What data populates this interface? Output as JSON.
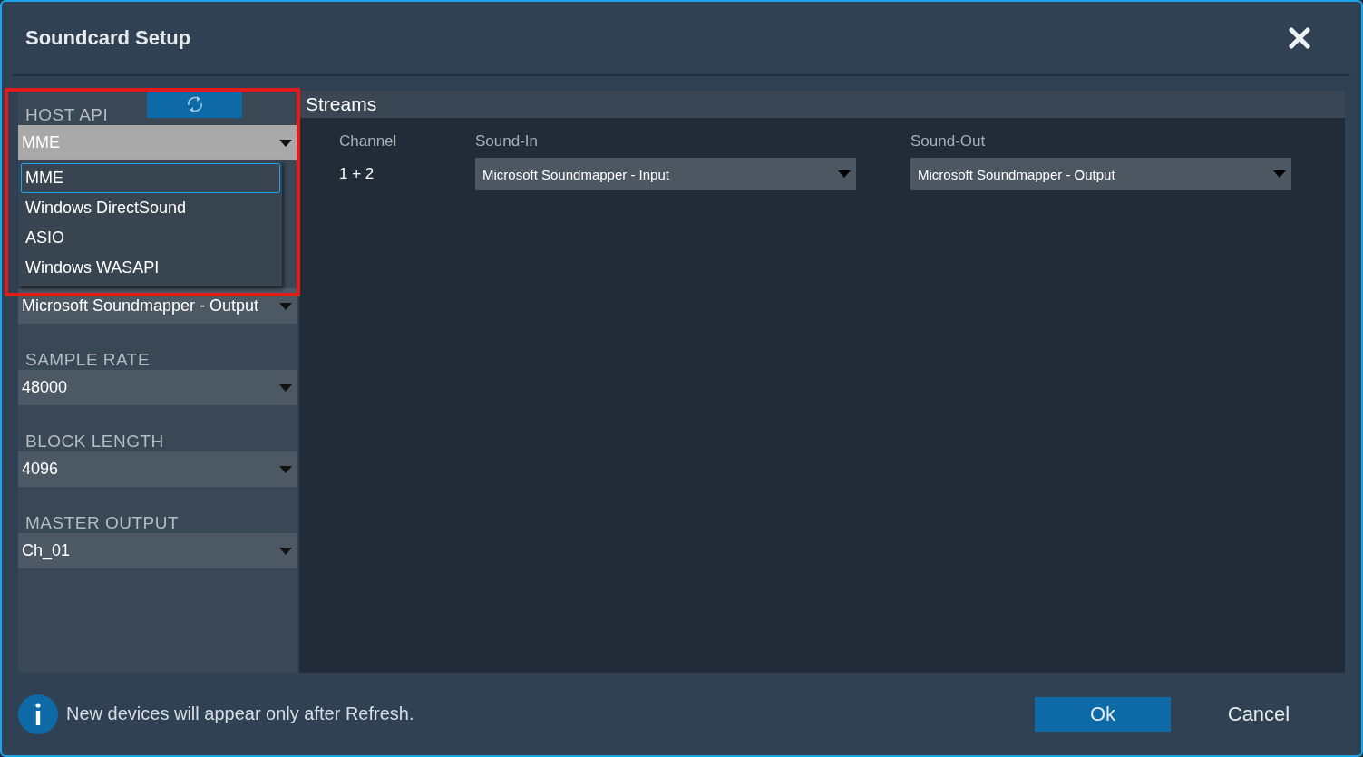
{
  "window": {
    "title": "Soundcard Setup"
  },
  "host_api": {
    "label": "HOST API",
    "value": "MME",
    "expanded": true,
    "options": [
      {
        "label": "MME",
        "selected": true
      },
      {
        "label": "Windows DirectSound",
        "selected": false
      },
      {
        "label": "ASIO",
        "selected": false
      },
      {
        "label": "Windows WASAPI",
        "selected": false
      }
    ]
  },
  "device_select": {
    "value": "Microsoft Soundmapper - Output"
  },
  "settings": [
    {
      "label": "SAMPLE RATE",
      "value": "48000"
    },
    {
      "label": "BLOCK LENGTH",
      "value": "4096"
    },
    {
      "label": "MASTER OUTPUT",
      "value": "Ch_01"
    }
  ],
  "streams": {
    "title": "Streams",
    "columns": [
      "Channel",
      "Sound-In",
      "Sound-Out"
    ],
    "rows": [
      {
        "channel": "1 + 2",
        "sound_in": "Microsoft Soundmapper - Input",
        "sound_out": "Microsoft Soundmapper - Output"
      }
    ]
  },
  "footer": {
    "info": "New devices will appear only after Refresh.",
    "buttons": [
      {
        "label": "Ok",
        "kind": "primary"
      },
      {
        "label": "Cancel",
        "kind": "plain"
      }
    ]
  }
}
